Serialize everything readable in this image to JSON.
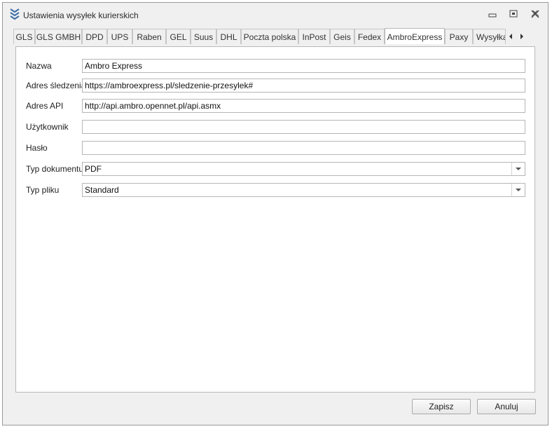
{
  "window": {
    "title": "Ustawienia wysyłek kurierskich"
  },
  "tabs": [
    {
      "label": "GLS"
    },
    {
      "label": "GLS GMBH"
    },
    {
      "label": "DPD"
    },
    {
      "label": "UPS"
    },
    {
      "label": "Raben"
    },
    {
      "label": "GEL"
    },
    {
      "label": "Suus"
    },
    {
      "label": "DHL"
    },
    {
      "label": "Poczta polska"
    },
    {
      "label": "InPost"
    },
    {
      "label": "Geis"
    },
    {
      "label": "Fedex"
    },
    {
      "label": "AmbroExpress"
    },
    {
      "label": "Paxy"
    },
    {
      "label": "Wysyłka"
    }
  ],
  "active_tab": "AmbroExpress",
  "form": {
    "nazwa": {
      "label": "Nazwa",
      "value": "Ambro Express"
    },
    "adres_sledzenia": {
      "label": "Adres śledzenia",
      "value": "https://ambroexpress.pl/sledzenie-przesylek#"
    },
    "adres_api": {
      "label": "Adres API",
      "value": "http://api.ambro.opennet.pl/api.asmx"
    },
    "uzytkownik": {
      "label": "Użytkownik",
      "value": ""
    },
    "haslo": {
      "label": "Hasło",
      "value": ""
    },
    "typ_dokumentu": {
      "label": "Typ dokumentu",
      "value": "PDF"
    },
    "typ_pliku": {
      "label": "Typ pliku",
      "value": "Standard"
    }
  },
  "buttons": {
    "save": "Zapisz",
    "cancel": "Anuluj"
  },
  "colors": {
    "accent": "#3d6ea8",
    "border": "#b6b6b6",
    "window_bg": "#f0f0f0"
  }
}
